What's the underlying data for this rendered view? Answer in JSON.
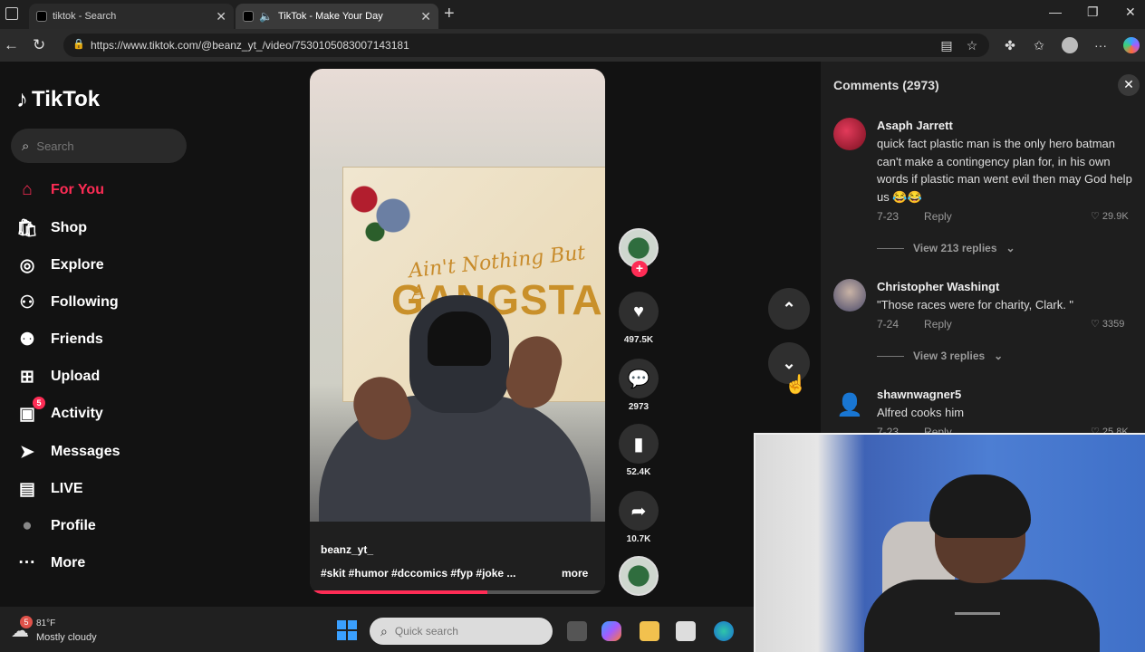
{
  "browser": {
    "tabs": [
      {
        "title": "tiktok - Search"
      },
      {
        "title": "TikTok - Make Your Day"
      }
    ],
    "url": "https://www.tiktok.com/@beanz_yt_/video/7530105083007143181"
  },
  "sidebar": {
    "logo": "TikTok",
    "search_placeholder": "Search",
    "items": [
      {
        "label": "For You",
        "icon": "home-icon",
        "glyph": "⌂"
      },
      {
        "label": "Shop",
        "icon": "shop-bag-icon",
        "glyph": "🛍"
      },
      {
        "label": "Explore",
        "icon": "compass-icon",
        "glyph": "◎"
      },
      {
        "label": "Following",
        "icon": "following-person-icon",
        "glyph": "⚇"
      },
      {
        "label": "Friends",
        "icon": "friends-icon",
        "glyph": "⚉"
      },
      {
        "label": "Upload",
        "icon": "upload-plus-icon",
        "glyph": "⊞"
      },
      {
        "label": "Activity",
        "icon": "activity-inbox-icon",
        "glyph": "▣",
        "badge": "5"
      },
      {
        "label": "Messages",
        "icon": "paper-plane-icon",
        "glyph": "➤"
      },
      {
        "label": "LIVE",
        "icon": "live-tv-icon",
        "glyph": "▤"
      },
      {
        "label": "Profile",
        "icon": "profile-avatar-icon",
        "glyph": "●"
      },
      {
        "label": "More",
        "icon": "more-dots-icon",
        "glyph": "···"
      }
    ]
  },
  "video": {
    "banner_line1": "Ain't Nothing But A",
    "banner_line2": "GANGSTA",
    "username": "beanz_yt_",
    "tags": "#skit  #humor  #dccomics  #fyp  #joke ...",
    "more": "more",
    "progress": 0.6
  },
  "actions": {
    "likes": "497.5K",
    "comments": "2973",
    "saves": "52.4K",
    "shares": "10.7K"
  },
  "comments_panel": {
    "title": "Comments (2973)",
    "items": [
      {
        "name": "Asaph Jarrett",
        "text": "quick fact plastic man is the only hero batman can't make a contingency plan for, in his own words if plastic man went evil then may God help us 😂😂",
        "date": "7-23",
        "reply": "Reply",
        "likes": "29.9K",
        "view_replies": "View 213 replies"
      },
      {
        "name": "Christopher Washingt",
        "text": "\"Those races were for charity, Clark. \"",
        "date": "7-24",
        "reply": "Reply",
        "likes": "3359",
        "view_replies": "View 3 replies"
      },
      {
        "name": "shawnwagner5",
        "text": "Alfred cooks him",
        "date": "7-23",
        "reply": "Reply",
        "likes": "25.8K"
      }
    ]
  },
  "taskbar": {
    "weather_badge": "5",
    "temp": "81°F",
    "desc": "Mostly cloudy",
    "search_placeholder": "Quick search"
  },
  "colors": {
    "accent": "#fe2c55",
    "panel": "#1e1e1e",
    "background": "#121212"
  }
}
